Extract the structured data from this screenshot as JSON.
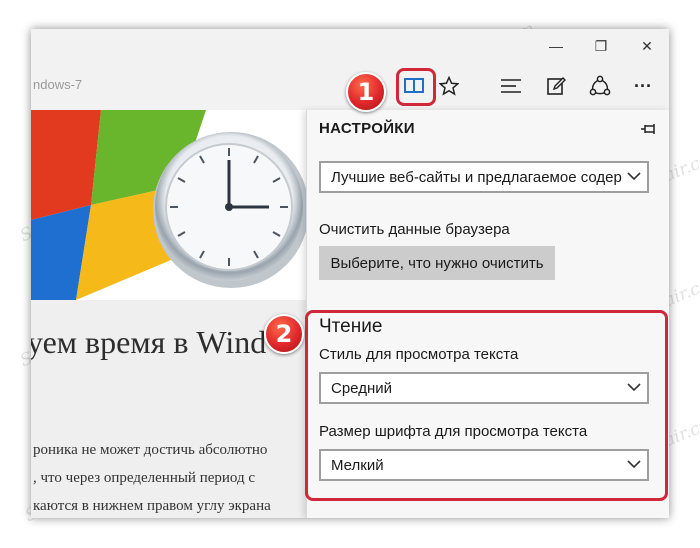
{
  "window": {
    "minimize_glyph": "—",
    "maximize_glyph": "❐",
    "close_glyph": "✕"
  },
  "toolbar": {
    "url_fragment": "ndows-7",
    "icons": [
      "reading-view-icon",
      "favorite-star-icon",
      "hub-icon",
      "web-note-icon",
      "share-icon",
      "more-icon"
    ],
    "more_label": "···"
  },
  "page": {
    "title_fragment": "уем время в Wind",
    "text_lines": [
      "роника не может достичь абсолютно",
      ", что через определенный период с",
      "каются в нижнем правом углу экрана"
    ]
  },
  "panel": {
    "title": "НАСТРОЙКИ",
    "open_with_value": "Лучшие веб-сайты и предлагаемое содер",
    "clear_data_label": "Очистить данные браузера",
    "clear_button": "Выберите, что нужно очистить",
    "reading": {
      "heading": "Чтение",
      "style_label": "Стиль для просмотра текста",
      "style_value": "Средний",
      "font_size_label": "Размер шрифта для просмотра текста",
      "font_size_value": "Мелкий"
    }
  },
  "annotations": {
    "step1": "1",
    "step2": "2",
    "accent_color": "#d0283a"
  },
  "watermark": "Soringpcrepair.com"
}
